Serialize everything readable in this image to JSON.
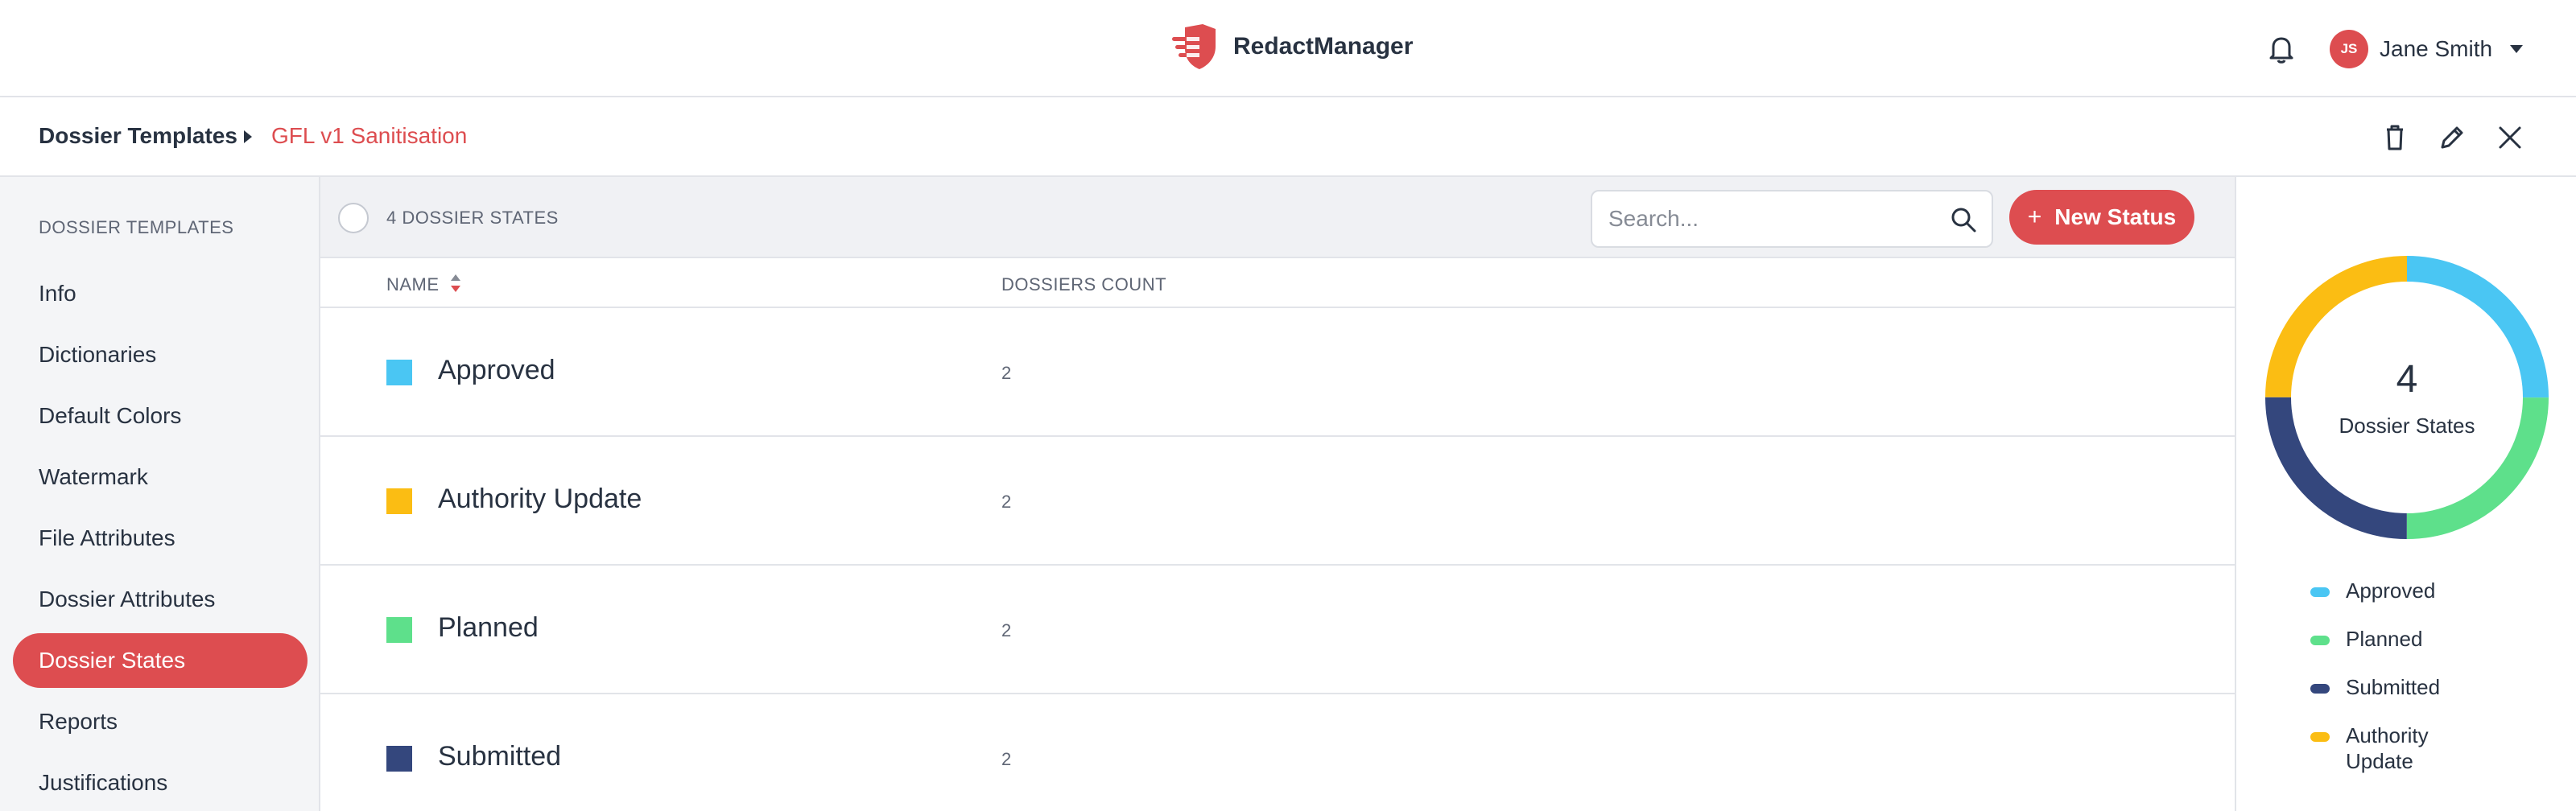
{
  "app": {
    "name": "RedactManager"
  },
  "user": {
    "initials": "JS",
    "name": "Jane Smith"
  },
  "breadcrumb": {
    "root": "Dossier Templates",
    "current": "GFL v1 Sanitisation"
  },
  "sidebar": {
    "title": "DOSSIER TEMPLATES",
    "items": [
      {
        "label": "Info"
      },
      {
        "label": "Dictionaries"
      },
      {
        "label": "Default Colors"
      },
      {
        "label": "Watermark"
      },
      {
        "label": "File Attributes"
      },
      {
        "label": "Dossier Attributes"
      },
      {
        "label": "Dossier States",
        "active": true
      },
      {
        "label": "Reports"
      },
      {
        "label": "Justifications"
      }
    ]
  },
  "list": {
    "count_label": "4 DOSSIER STATES",
    "search_placeholder": "Search...",
    "new_button": "New Status",
    "columns": {
      "name": "NAME",
      "count": "DOSSIERS COUNT"
    },
    "rows": [
      {
        "name": "Approved",
        "count": "2",
        "color": "#4ac6f3"
      },
      {
        "name": "Authority Update",
        "count": "2",
        "color": "#fbbd13"
      },
      {
        "name": "Planned",
        "count": "2",
        "color": "#5ee08b"
      },
      {
        "name": "Submitted",
        "count": "2",
        "color": "#34477d"
      }
    ]
  },
  "stats": {
    "total": "4",
    "label": "Dossier States",
    "legend": [
      {
        "label": "Approved",
        "color": "#4ac6f3"
      },
      {
        "label": "Planned",
        "color": "#5ee08b"
      },
      {
        "label": "Submitted",
        "color": "#34477d"
      },
      {
        "label": "Authority Update",
        "color": "#fbbd13"
      }
    ]
  },
  "colors": {
    "accent": "#dd4d50",
    "text": "#283241",
    "muted": "#5f6675"
  },
  "icons": {
    "brand": "shield-logo-icon",
    "notifications": "bell-icon",
    "delete": "trash-icon",
    "edit": "pencil-icon",
    "close": "close-icon",
    "search": "search-icon",
    "sort": "sort-icon"
  }
}
